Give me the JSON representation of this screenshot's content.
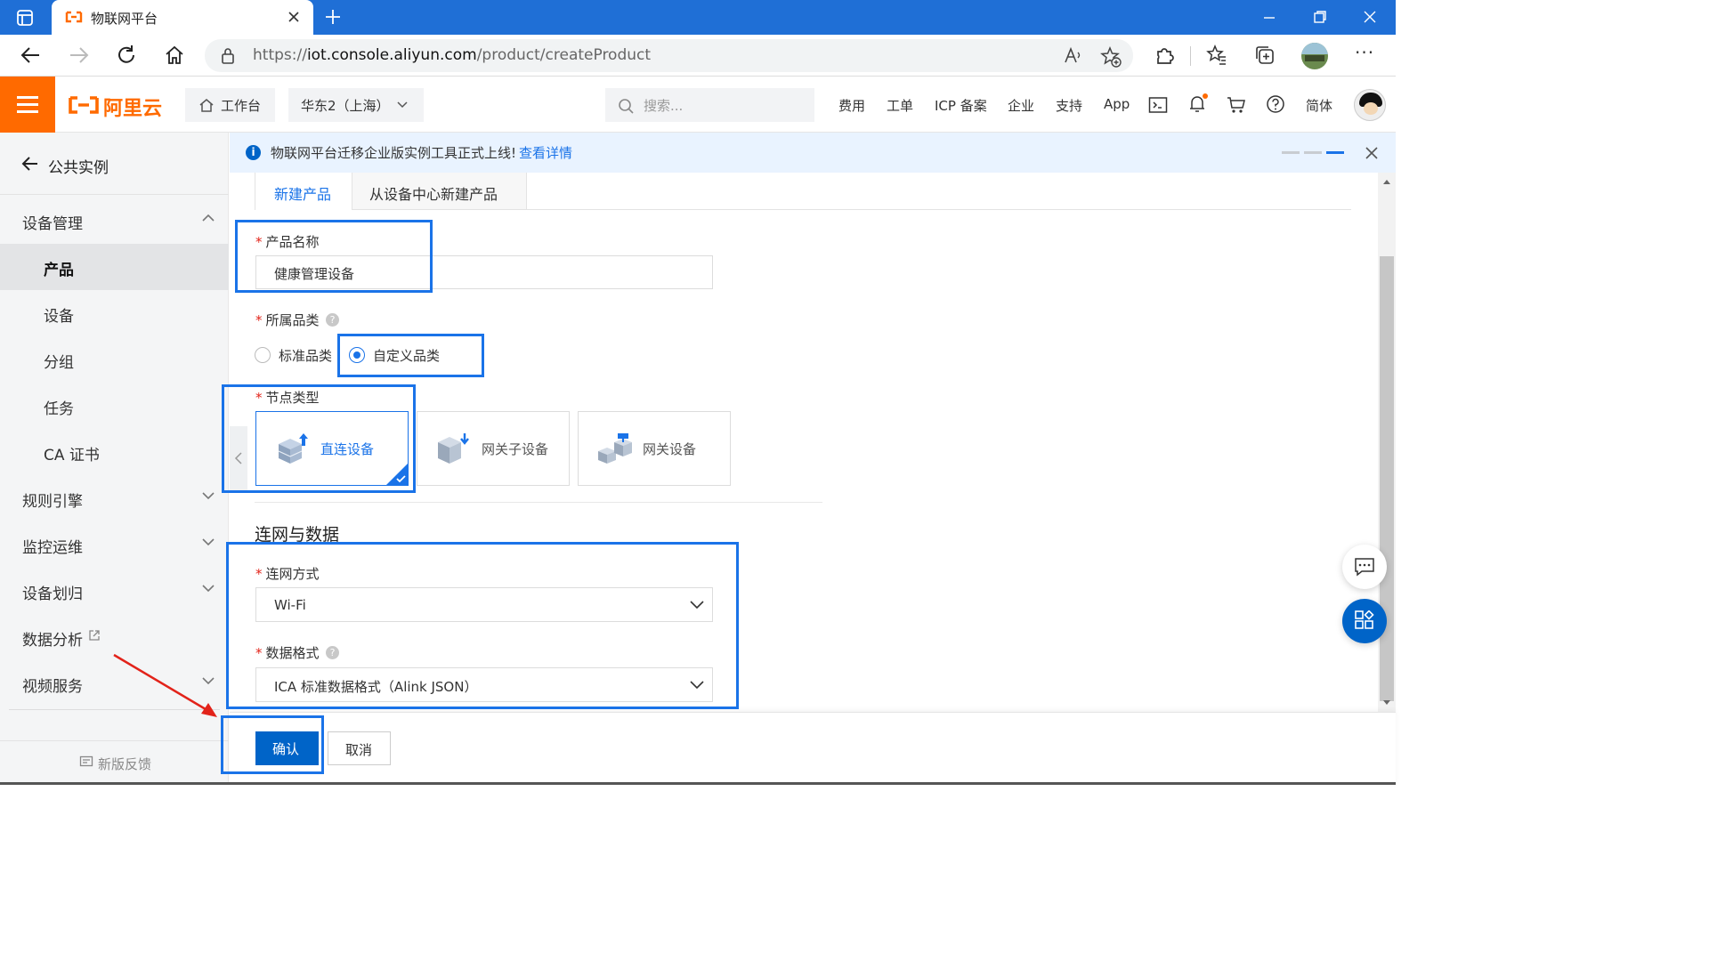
{
  "browser": {
    "tab_title": "物联网平台",
    "url_prefix": "https://",
    "url_host": "iot.console.aliyun.com",
    "url_path": "/product/createProduct"
  },
  "topnav": {
    "logo_text": "阿里云",
    "workbench": "工作台",
    "region": "华东2（上海）",
    "search_placeholder": "搜索...",
    "links": [
      "费用",
      "工单",
      "ICP 备案",
      "企业",
      "支持",
      "App"
    ],
    "lang": "简体"
  },
  "sidebar": {
    "back_label": "公共实例",
    "items": [
      {
        "label": "设备管理"
      },
      {
        "label": "产品"
      },
      {
        "label": "设备"
      },
      {
        "label": "分组"
      },
      {
        "label": "任务"
      },
      {
        "label": "CA 证书"
      },
      {
        "label": "规则引擎"
      },
      {
        "label": "监控运维"
      },
      {
        "label": "设备划归"
      },
      {
        "label": "数据分析"
      },
      {
        "label": "视频服务"
      }
    ],
    "feedback": "新版反馈"
  },
  "banner": {
    "text": "物联网平台迁移企业版实例工具正式上线!",
    "link": "查看详情"
  },
  "tabs": [
    "新建产品",
    "从设备中心新建产品"
  ],
  "form": {
    "product_name_label": "产品名称",
    "product_name_value": "健康管理设备",
    "category_label": "所属品类",
    "category_options": [
      "标准品类",
      "自定义品类"
    ],
    "node_type_label": "节点类型",
    "node_types": [
      "直连设备",
      "网关子设备",
      "网关设备"
    ],
    "section_title": "连网与数据",
    "network_label": "连网方式",
    "network_value": "Wi-Fi",
    "data_format_label": "数据格式",
    "data_format_value": "ICA 标准数据格式（Alink JSON）"
  },
  "footer": {
    "confirm": "确认",
    "cancel": "取消"
  },
  "colors": {
    "accent": "#1a73e8",
    "brand_orange": "#ff6a00",
    "required": "#e2231a",
    "highlight_box": "#1a73e8",
    "annotation_arrow": "#e2231a"
  }
}
